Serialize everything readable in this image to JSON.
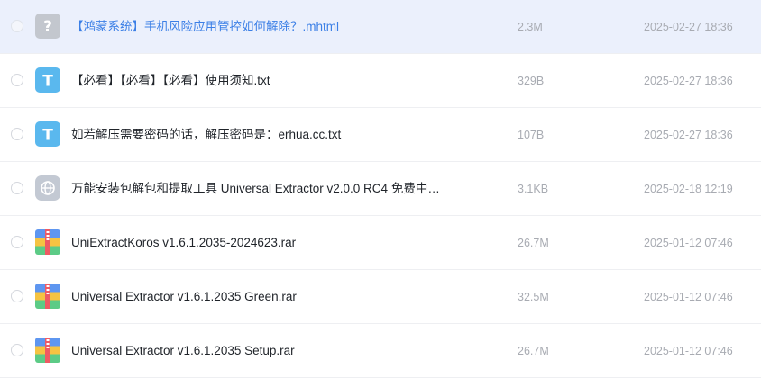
{
  "files": [
    {
      "name": "【鸿蒙系统】手机风险应用管控如何解除？.mhtml",
      "size": "2.3M",
      "date": "2025-02-27 18:36",
      "icon": "unknown-file-icon",
      "selected": true
    },
    {
      "name": "【必看】【必看】【必看】使用须知.txt",
      "size": "329B",
      "date": "2025-02-27 18:36",
      "icon": "text-file-icon"
    },
    {
      "name": "如若解压需要密码的话，解压密码是：erhua.cc.txt",
      "size": "107B",
      "date": "2025-02-27 18:36",
      "icon": "text-file-icon"
    },
    {
      "name": "万能安装包解包和提取工具 Universal Extractor v2.0.0 RC4 免费中…",
      "size": "3.1KB",
      "date": "2025-02-18 12:19",
      "icon": "web-link-icon"
    },
    {
      "name": "UniExtractKoros v1.6.1.2035-2024623.rar",
      "size": "26.7M",
      "date": "2025-01-12 07:46",
      "icon": "archive-file-icon"
    },
    {
      "name": "Universal Extractor v1.6.1.2035 Green.rar",
      "size": "32.5M",
      "date": "2025-01-12 07:46",
      "icon": "archive-file-icon"
    },
    {
      "name": "Universal Extractor v1.6.1.2035 Setup.rar",
      "size": "26.7M",
      "date": "2025-01-12 07:46",
      "icon": "archive-file-icon"
    }
  ],
  "colors": {
    "selected_row_bg": "#ebf0fc",
    "selected_text": "#3b7fe6",
    "meta_text": "#a8abb2",
    "text_icon": "#5ab8ee",
    "unknown_icon": "#c3c7ce"
  }
}
